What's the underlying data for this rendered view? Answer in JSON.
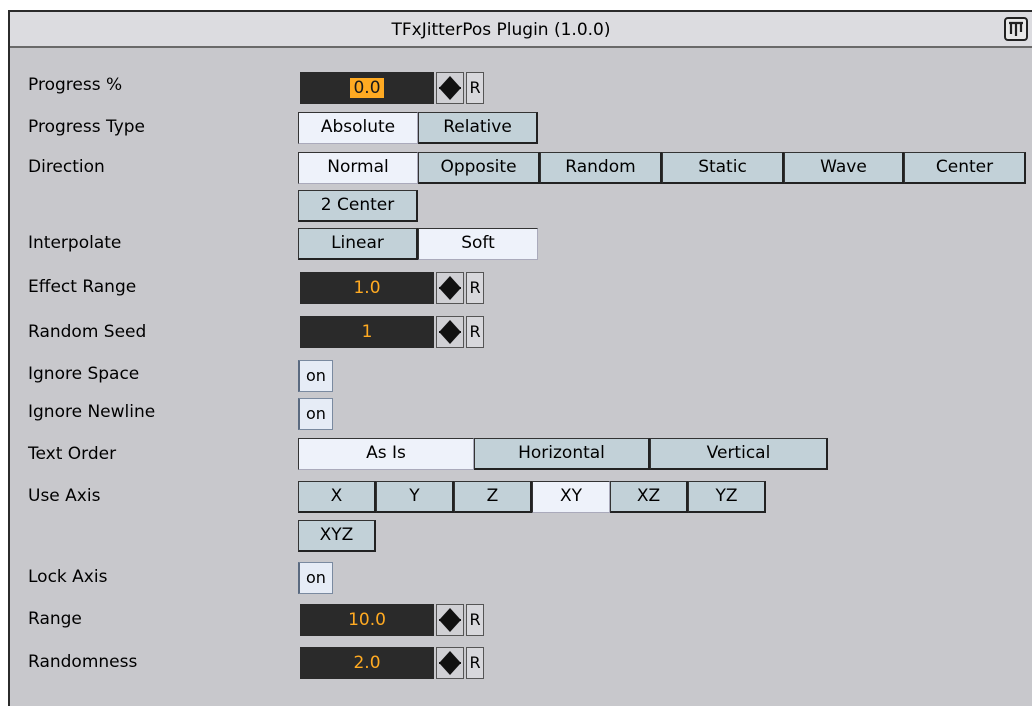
{
  "window": {
    "title": "TFxJitterPos Plugin (1.0.0)",
    "icon": "plugin-icon"
  },
  "rows": {
    "progress": {
      "label": "Progress %",
      "value": "0.0",
      "reset": "R"
    },
    "progress_type": {
      "label": "Progress Type",
      "options": [
        "Absolute",
        "Relative"
      ],
      "selected": "Absolute"
    },
    "direction": {
      "label": "Direction",
      "options": [
        "Normal",
        "Opposite",
        "Random",
        "Static",
        "Wave",
        "Center",
        "2 Center"
      ],
      "selected": "Normal"
    },
    "interpolate": {
      "label": "Interpolate",
      "options": [
        "Linear",
        "Soft"
      ],
      "selected": "Soft"
    },
    "effect_range": {
      "label": "Effect Range",
      "value": "1.0",
      "reset": "R"
    },
    "random_seed": {
      "label": "Random Seed",
      "value": "1",
      "reset": "R"
    },
    "ignore_space": {
      "label": "Ignore Space",
      "state": "on"
    },
    "ignore_newline": {
      "label": "Ignore Newline",
      "state": "on"
    },
    "text_order": {
      "label": "Text Order",
      "options": [
        "As Is",
        "Horizontal",
        "Vertical"
      ],
      "selected": "As Is"
    },
    "use_axis": {
      "label": "Use Axis",
      "options": [
        "X",
        "Y",
        "Z",
        "XY",
        "XZ",
        "YZ",
        "XYZ"
      ],
      "selected": "XY"
    },
    "lock_axis": {
      "label": "Lock Axis",
      "state": "on"
    },
    "range": {
      "label": "Range",
      "value": "10.0",
      "reset": "R"
    },
    "randomness": {
      "label": "Randomness",
      "value": "2.0",
      "reset": "R"
    }
  },
  "colors": {
    "panel_bg": "#c8c8cc",
    "field_bg": "#2a2a2a",
    "field_text": "#ffaa22",
    "button_bg": "#c2d1d8",
    "button_selected_bg": "#eef2fa"
  }
}
